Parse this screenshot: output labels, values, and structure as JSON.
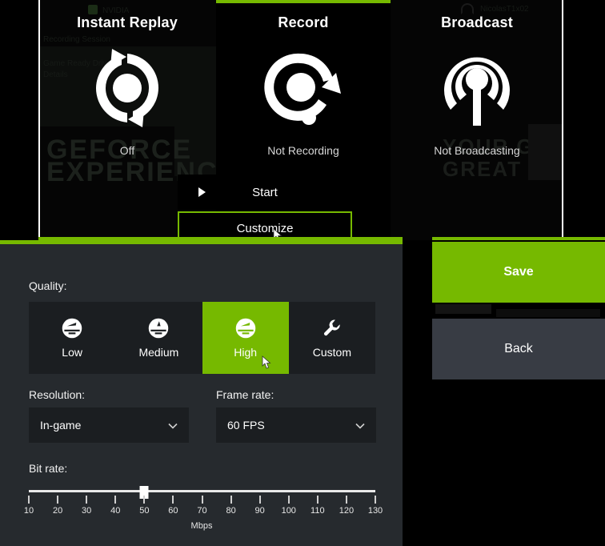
{
  "overlay": {
    "panels": [
      {
        "id": "instant-replay",
        "title": "Instant Replay",
        "status": "Off",
        "icon": "instant-replay-icon"
      },
      {
        "id": "record",
        "title": "Record",
        "status": "Not Recording",
        "icon": "record-icon"
      },
      {
        "id": "broadcast",
        "title": "Broadcast",
        "status": "Not Broadcasting",
        "icon": "broadcast-icon"
      }
    ],
    "actions": {
      "start_label": "Start",
      "customize_label": "Customize"
    }
  },
  "settings": {
    "quality": {
      "label": "Quality:",
      "options": [
        {
          "label": "Low",
          "icon": "gauge-icon",
          "selected": false
        },
        {
          "label": "Medium",
          "icon": "gauge-icon",
          "selected": false
        },
        {
          "label": "High",
          "icon": "gauge-icon",
          "selected": true
        },
        {
          "label": "Custom",
          "icon": "wrench-icon",
          "selected": false
        }
      ],
      "selected": "High"
    },
    "resolution": {
      "label": "Resolution:",
      "value": "In-game"
    },
    "frame_rate": {
      "label": "Frame rate:",
      "value": "60 FPS"
    },
    "bit_rate": {
      "label": "Bit rate:",
      "unit": "Mbps",
      "value": 50,
      "min": 10,
      "max": 130,
      "ticks": [
        10,
        20,
        30,
        40,
        50,
        60,
        70,
        80,
        90,
        100,
        110,
        120,
        130
      ]
    }
  },
  "side_actions": {
    "save_label": "Save",
    "back_label": "Back"
  },
  "background": {
    "watermark_line1": "GEFORCE",
    "watermark_line2": "EXPERIENCE",
    "tagline_line1": "YOUR GATEWAY",
    "tagline_line2": "GREAT PC GAM",
    "nvidia_label": "NVIDIA",
    "driver_text": "Game Ready Driver",
    "driver_sub": "Details",
    "session_text": "Recording Session",
    "account_name": "NicolasT1x02"
  },
  "colors": {
    "accent_green": "#76b900",
    "panel_bg": "#262a2e",
    "control_bg": "#1b1e21",
    "back_btn": "#383c44",
    "overlay_bg": "#000000"
  }
}
